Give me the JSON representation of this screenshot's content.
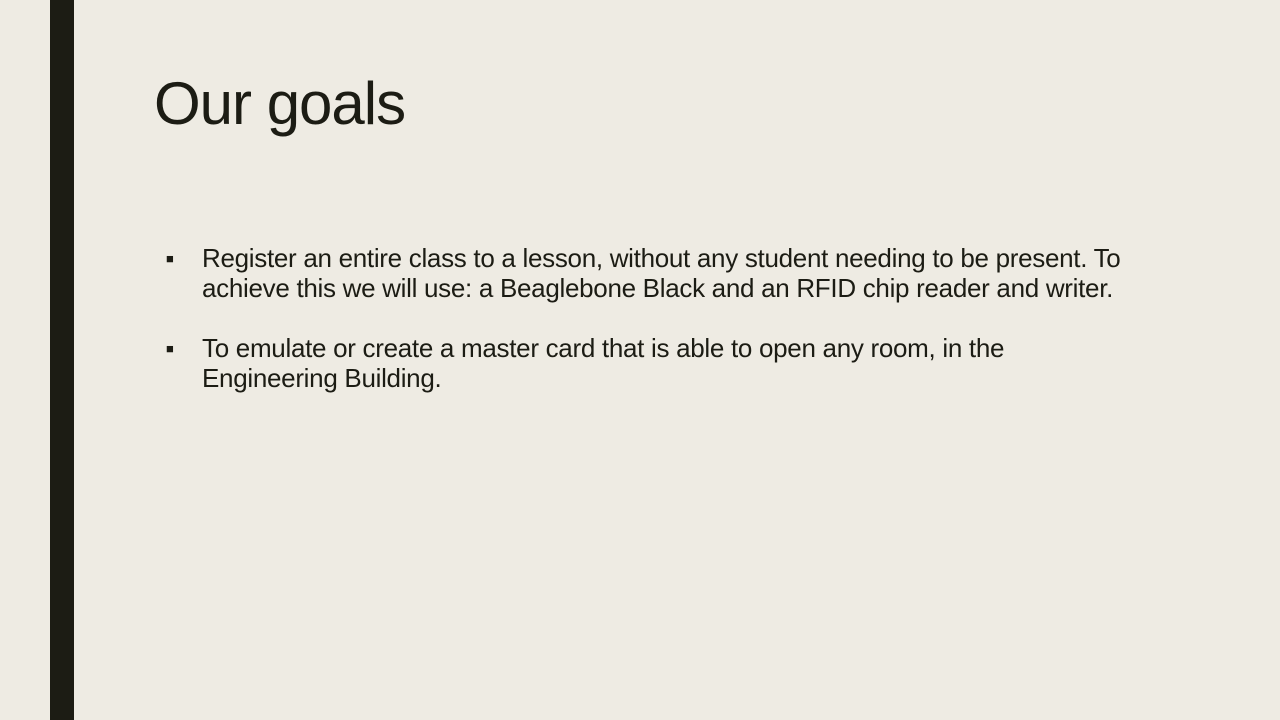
{
  "slide": {
    "title": "Our goals",
    "bullets": [
      {
        "marker": "■",
        "text": "Register an entire class to a lesson, without any student needing to be present. To achieve this we will use: a Beaglebone Black and an RFID chip reader and writer."
      },
      {
        "marker": "■",
        "text": "To emulate or create a master card that is able to open any room, in the Engineering Building."
      }
    ]
  },
  "colors": {
    "background": "#EEEBE3",
    "accent_bar": "#1C1C14",
    "text": "#1C1C14"
  }
}
